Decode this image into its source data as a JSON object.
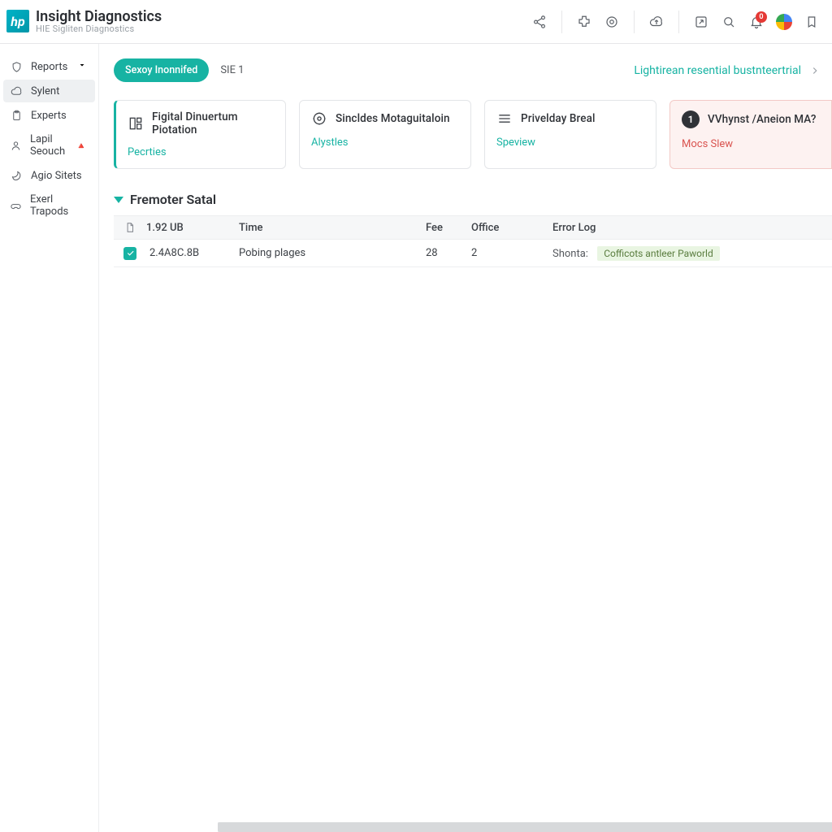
{
  "brand": {
    "logo_text": "hp",
    "title": "Insight Diagnostics",
    "subtitle": "HIE Sigliten Diagnostics"
  },
  "header_badge": "0",
  "sidebar": {
    "items": [
      {
        "label": "Reports"
      },
      {
        "label": "Sylent"
      },
      {
        "label": "Experts"
      },
      {
        "label": "Lapil Seouch",
        "beta": "🔺"
      },
      {
        "label": "Agio Sitets"
      },
      {
        "label": "Exerl Trapods"
      }
    ]
  },
  "toprow": {
    "pill": "Sexoy Inonnifed",
    "sie": "SIE 1",
    "lightlink": "Lightirean resential bustnteertrial"
  },
  "cards": [
    {
      "title": "Figital Dinuertum Piotation",
      "link": "Pecrties"
    },
    {
      "title": "Sincldes Motaguitaloin",
      "link": "Alystles"
    },
    {
      "title": "Privelday Breal",
      "link": "Speview"
    },
    {
      "title": "VVhynst /Aneion MA?",
      "link": "Mocs Slew",
      "num": "1"
    }
  ],
  "section": {
    "title": "Fremoter Satal"
  },
  "table": {
    "headers": {
      "size": "1.92 UB",
      "time": "Time",
      "fee": "Fee",
      "office": "Office",
      "error": "Error Log"
    },
    "rows": [
      {
        "size": "2.4A8C.8B",
        "time": "Pobing plages",
        "fee": "28",
        "office": "2",
        "error_lead": "Shonta:",
        "error_chip": "Cofficots antleer Paworld"
      }
    ]
  }
}
